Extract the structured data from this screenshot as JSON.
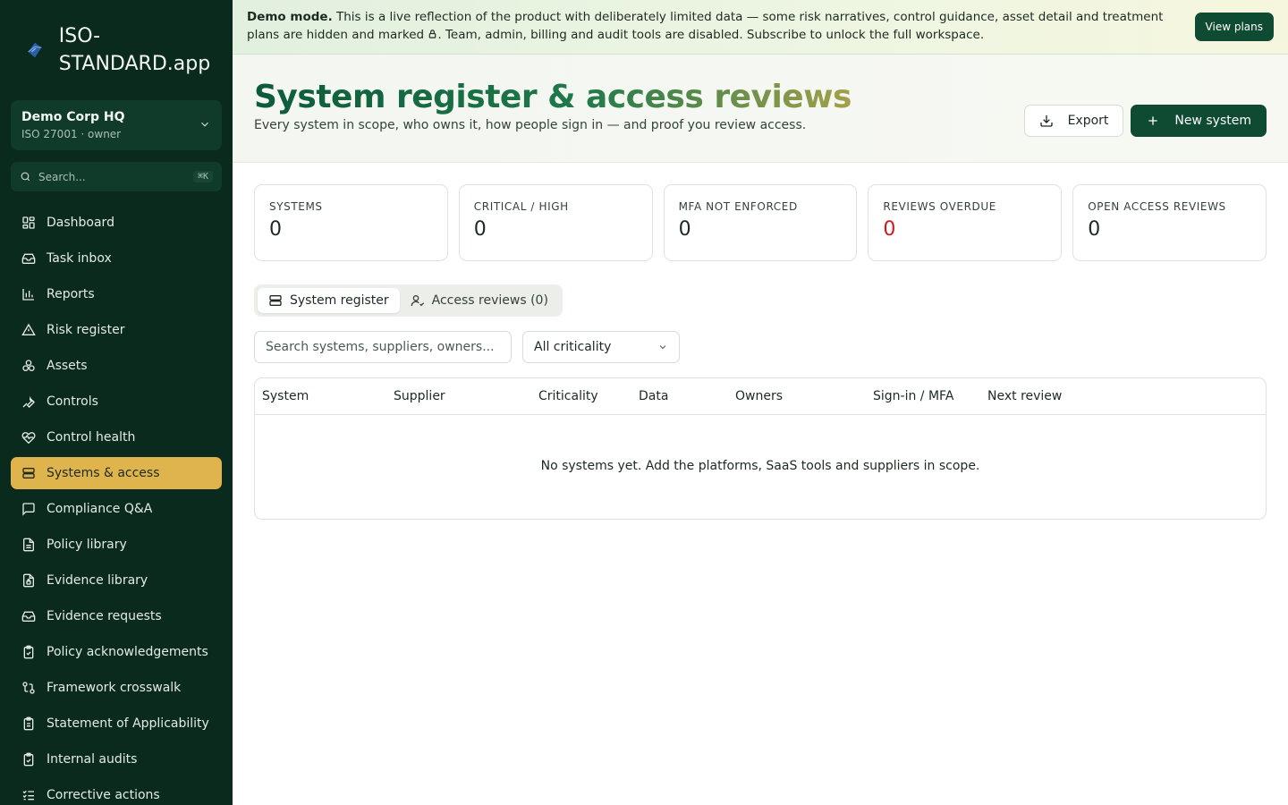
{
  "brand": {
    "name": "ISO-STANDARD.app"
  },
  "org": {
    "name": "Demo Corp HQ",
    "sub": "ISO 27001 · owner"
  },
  "search": {
    "placeholder": "Search...",
    "shortcut": "⌘K"
  },
  "nav": [
    {
      "label": "Dashboard",
      "icon": "dashboard-icon"
    },
    {
      "label": "Task inbox",
      "icon": "inbox-icon"
    },
    {
      "label": "Reports",
      "icon": "bar-chart-icon"
    },
    {
      "label": "Risk register",
      "icon": "warning-triangle-icon"
    },
    {
      "label": "Assets",
      "icon": "boxes-icon"
    },
    {
      "label": "Controls",
      "icon": "wrench-icon"
    },
    {
      "label": "Control health",
      "icon": "heart-pulse-icon"
    },
    {
      "label": "Systems & access",
      "icon": "server-icon",
      "active": true
    },
    {
      "label": "Compliance Q&A",
      "icon": "message-icon"
    },
    {
      "label": "Policy library",
      "icon": "document-icon"
    },
    {
      "label": "Evidence library",
      "icon": "file-lock-icon"
    },
    {
      "label": "Evidence requests",
      "icon": "inbox-icon"
    },
    {
      "label": "Policy acknowledgements",
      "icon": "clipboard-check-icon"
    },
    {
      "label": "Framework crosswalk",
      "icon": "git-compare-icon"
    },
    {
      "label": "Statement of Applicability",
      "icon": "clipboard-icon"
    },
    {
      "label": "Internal audits",
      "icon": "clipboard-check-icon"
    },
    {
      "label": "Corrective actions",
      "icon": "list-check-icon"
    }
  ],
  "banner": {
    "lead": "Demo mode.",
    "text_before_icon": " This is a live reflection of the product with deliberately limited data — some risk narratives, control guidance, asset detail and treatment plans are hidden and marked ",
    "text_after_icon": ". Team, admin, billing and audit tools are disabled. Subscribe to unlock the full workspace.",
    "button": "View plans"
  },
  "header": {
    "title": "System register & access reviews",
    "subtitle": "Every system in scope, who owns it, how people sign in — and proof you review access.",
    "export_label": "Export",
    "new_label": "New system"
  },
  "stats": [
    {
      "label": "SYSTEMS",
      "value": "0"
    },
    {
      "label": "CRITICAL / HIGH",
      "value": "0"
    },
    {
      "label": "MFA NOT ENFORCED",
      "value": "0"
    },
    {
      "label": "REVIEWS OVERDUE",
      "value": "0",
      "color": "#d01a1a"
    },
    {
      "label": "OPEN ACCESS REVIEWS",
      "value": "0"
    }
  ],
  "tabs": [
    {
      "label": "System register",
      "active": true
    },
    {
      "label": "Access reviews (0)"
    }
  ],
  "filters": {
    "search_placeholder": "Search systems, suppliers, owners...",
    "criticality": "All criticality"
  },
  "table": {
    "columns": [
      "System",
      "Supplier",
      "Criticality",
      "Data",
      "Owners",
      "Sign-in / MFA",
      "Next review"
    ],
    "empty": "No systems yet. Add the platforms, SaaS tools and suppliers in scope."
  },
  "colors": {
    "sidebar": "#0b2a1e",
    "accent": "#e0b44c",
    "primary": "#0f4a32",
    "danger": "#d01a1a"
  }
}
